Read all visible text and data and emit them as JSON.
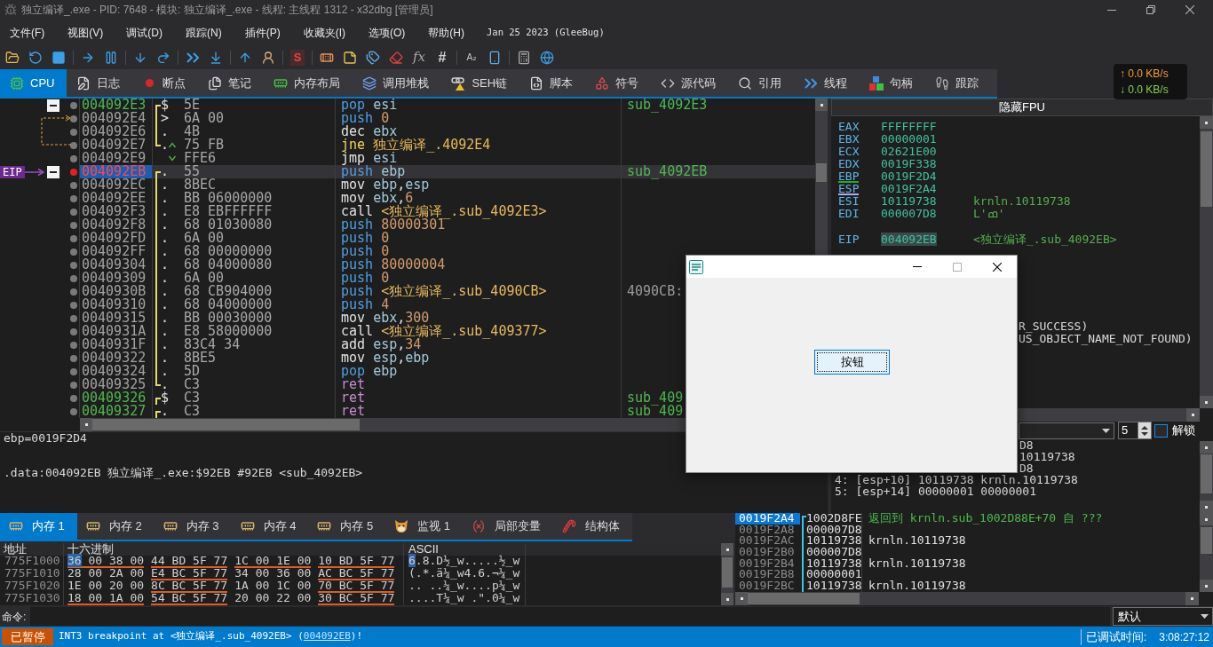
{
  "window": {
    "title": "独立编译_.exe - PID: 7648 - 模块: 独立编译_.exe - 线程: 主线程 1312 - x32dbg [管理员]"
  },
  "menu": [
    "文件(F)",
    "视图(V)",
    "调试(D)",
    "跟踪(N)",
    "插件(P)",
    "收藏夹(I)",
    "选项(O)",
    "帮助(H)"
  ],
  "build_info": "Jan 25 2023 (GleeBug)",
  "toolbar": {
    "glyphs": [
      "S",
      "fx",
      "#",
      "A₂"
    ]
  },
  "net_speed": {
    "upload": "↑ 0.0 KB/s",
    "download": "↓ 0.0 KB/s"
  },
  "tabs": [
    {
      "label": "CPU",
      "selected": true
    },
    {
      "label": "日志",
      "selected": false
    },
    {
      "label": "断点",
      "selected": false
    },
    {
      "label": "笔记",
      "selected": false
    },
    {
      "label": "内存布局",
      "selected": false
    },
    {
      "label": "调用堆栈",
      "selected": false
    },
    {
      "label": "SEH链",
      "selected": false
    },
    {
      "label": "脚本",
      "selected": false
    },
    {
      "label": "符号",
      "selected": false
    },
    {
      "label": "源代码",
      "selected": false
    },
    {
      "label": "引用",
      "selected": false
    },
    {
      "label": "线程",
      "selected": false
    },
    {
      "label": "句柄",
      "selected": false
    },
    {
      "label": "跟踪",
      "selected": false
    }
  ],
  "disassembly": {
    "eip_label": "EIP",
    "rows": [
      {
        "address": "004092E3",
        "kind": "function",
        "breakpoint": false,
        "selected": false,
        "collapse": true,
        "bracket": {
          "kind": "start"
        },
        "marker": "$",
        "bytes": "5E",
        "mnemonic": {
          "text": "pop",
          "kind": "stack"
        },
        "operands": [
          {
            "text": "esi",
            "kind": "reg"
          }
        ],
        "comment": {
          "text": "sub_4092E3",
          "kind": "label"
        }
      },
      {
        "address": "004092E4",
        "kind": "plain",
        "breakpoint": false,
        "selected": false,
        "collapse": false,
        "jump": {
          "kind": "target"
        },
        "bracket": {
          "kind": "mid"
        },
        "marker": ">",
        "bytes": "6A 00",
        "mnemonic": {
          "text": "push",
          "kind": "stack"
        },
        "operands": [
          {
            "text": "0",
            "kind": "num"
          }
        ]
      },
      {
        "address": "004092E6",
        "kind": "plain",
        "breakpoint": false,
        "selected": false,
        "collapse": false,
        "bracket": {
          "kind": "mid"
        },
        "marker": ".",
        "bytes": "4B",
        "mnemonic": {
          "text": "dec",
          "kind": "plain"
        },
        "operands": [
          {
            "text": "ebx",
            "kind": "reg"
          }
        ]
      },
      {
        "address": "004092E7",
        "kind": "plain",
        "breakpoint": false,
        "selected": false,
        "collapse": false,
        "jump": {
          "kind": "source"
        },
        "bracket": {
          "kind": "end"
        },
        "marker": ".",
        "branch": {
          "kind": "up"
        },
        "bytes": "75 FB",
        "mnemonic": {
          "text": "jne",
          "kind": "jcc"
        },
        "operands": [
          {
            "text": "独立编译_.4092E4",
            "kind": "target"
          }
        ]
      },
      {
        "address": "004092E9",
        "kind": "plain",
        "breakpoint": false,
        "selected": false,
        "collapse": false,
        "branch": {
          "kind": "down"
        },
        "bytes": "FFE6",
        "mnemonic": {
          "text": "jmp",
          "kind": "plain"
        },
        "operands": [
          {
            "text": "esi",
            "kind": "reg"
          }
        ]
      },
      {
        "address": "004092EB",
        "kind": "eip",
        "breakpoint": true,
        "selected": true,
        "collapse": true,
        "bracket": {
          "kind": "start"
        },
        "marker": ".",
        "bytes": "55",
        "mnemonic": {
          "text": "push",
          "kind": "stack"
        },
        "operands": [
          {
            "text": "ebp",
            "kind": "reg"
          }
        ],
        "comment": {
          "text": "sub_4092EB",
          "kind": "label"
        }
      },
      {
        "address": "004092EC",
        "kind": "plain",
        "breakpoint": false,
        "selected": false,
        "collapse": false,
        "bracket": {
          "kind": "mid"
        },
        "marker": ".",
        "bytes": "8BEC",
        "mnemonic": {
          "text": "mov",
          "kind": "plain"
        },
        "operands": [
          {
            "text": "ebp",
            "kind": "reg"
          },
          {
            "text": ",",
            "kind": "punct"
          },
          {
            "text": "esp",
            "kind": "reg"
          }
        ]
      },
      {
        "address": "004092EE",
        "kind": "plain",
        "breakpoint": false,
        "selected": false,
        "collapse": false,
        "bracket": {
          "kind": "mid"
        },
        "marker": ".",
        "bytes": "BB 06000000",
        "mnemonic": {
          "text": "mov",
          "kind": "plain"
        },
        "operands": [
          {
            "text": "ebx",
            "kind": "reg"
          },
          {
            "text": ",",
            "kind": "punct"
          },
          {
            "text": "6",
            "kind": "num"
          }
        ]
      },
      {
        "address": "004092F3",
        "kind": "plain",
        "breakpoint": false,
        "selected": false,
        "collapse": false,
        "bracket": {
          "kind": "mid"
        },
        "marker": ".",
        "bytes": "E8 EBFFFFFF",
        "mnemonic": {
          "text": "call",
          "kind": "plain"
        },
        "operands": [
          {
            "text": "<独立编译_.sub_4092E3>",
            "kind": "target"
          }
        ]
      },
      {
        "address": "004092F8",
        "kind": "plain",
        "breakpoint": false,
        "selected": false,
        "collapse": false,
        "bracket": {
          "kind": "mid"
        },
        "marker": ".",
        "bytes": "68 01030080",
        "mnemonic": {
          "text": "push",
          "kind": "stack"
        },
        "operands": [
          {
            "text": "80000301",
            "kind": "num"
          }
        ]
      },
      {
        "address": "004092FD",
        "kind": "plain",
        "breakpoint": false,
        "selected": false,
        "collapse": false,
        "bracket": {
          "kind": "mid"
        },
        "marker": ".",
        "bytes": "6A 00",
        "mnemonic": {
          "text": "push",
          "kind": "stack"
        },
        "operands": [
          {
            "text": "0",
            "kind": "num"
          }
        ]
      },
      {
        "address": "004092FF",
        "kind": "plain",
        "breakpoint": false,
        "selected": false,
        "collapse": false,
        "bracket": {
          "kind": "mid"
        },
        "marker": ".",
        "bytes": "68 00000000",
        "mnemonic": {
          "text": "push",
          "kind": "stack"
        },
        "operands": [
          {
            "text": "0",
            "kind": "num"
          }
        ]
      },
      {
        "address": "00409304",
        "kind": "plain",
        "breakpoint": false,
        "selected": false,
        "collapse": false,
        "bracket": {
          "kind": "mid"
        },
        "marker": ".",
        "bytes": "68 04000080",
        "mnemonic": {
          "text": "push",
          "kind": "stack"
        },
        "operands": [
          {
            "text": "80000004",
            "kind": "num"
          }
        ]
      },
      {
        "address": "00409309",
        "kind": "plain",
        "breakpoint": false,
        "selected": false,
        "collapse": false,
        "bracket": {
          "kind": "mid"
        },
        "marker": ".",
        "bytes": "6A 00",
        "mnemonic": {
          "text": "push",
          "kind": "stack"
        },
        "operands": [
          {
            "text": "0",
            "kind": "num"
          }
        ]
      },
      {
        "address": "0040930B",
        "kind": "plain",
        "breakpoint": false,
        "selected": false,
        "collapse": false,
        "bracket": {
          "kind": "mid"
        },
        "marker": ".",
        "bytes": "68 CB904000",
        "mnemonic": {
          "text": "push",
          "kind": "stack"
        },
        "operands": [
          {
            "text": "<独立编译_.sub_4090CB>",
            "kind": "target"
          }
        ],
        "comment": {
          "text": "4090CB:",
          "kind": "plain"
        }
      },
      {
        "address": "00409310",
        "kind": "plain",
        "breakpoint": false,
        "selected": false,
        "collapse": false,
        "bracket": {
          "kind": "mid"
        },
        "marker": ".",
        "bytes": "68 04000000",
        "mnemonic": {
          "text": "push",
          "kind": "stack"
        },
        "operands": [
          {
            "text": "4",
            "kind": "num"
          }
        ]
      },
      {
        "address": "00409315",
        "kind": "plain",
        "breakpoint": false,
        "selected": false,
        "collapse": false,
        "bracket": {
          "kind": "mid"
        },
        "marker": ".",
        "bytes": "BB 00030000",
        "mnemonic": {
          "text": "mov",
          "kind": "plain"
        },
        "operands": [
          {
            "text": "ebx",
            "kind": "reg"
          },
          {
            "text": ",",
            "kind": "punct"
          },
          {
            "text": "300",
            "kind": "num"
          }
        ]
      },
      {
        "address": "0040931A",
        "kind": "plain",
        "breakpoint": false,
        "selected": false,
        "collapse": false,
        "bracket": {
          "kind": "mid"
        },
        "marker": ".",
        "bytes": "E8 58000000",
        "mnemonic": {
          "text": "call",
          "kind": "plain"
        },
        "operands": [
          {
            "text": "<独立编译_.sub_409377>",
            "kind": "target"
          }
        ]
      },
      {
        "address": "0040931F",
        "kind": "plain",
        "breakpoint": false,
        "selected": false,
        "collapse": false,
        "bracket": {
          "kind": "mid"
        },
        "marker": ".",
        "bytes": "83C4 34",
        "mnemonic": {
          "text": "add",
          "kind": "plain"
        },
        "operands": [
          {
            "text": "esp",
            "kind": "reg"
          },
          {
            "text": ",",
            "kind": "punct"
          },
          {
            "text": "34",
            "kind": "num"
          }
        ]
      },
      {
        "address": "00409322",
        "kind": "plain",
        "breakpoint": false,
        "selected": false,
        "collapse": false,
        "bracket": {
          "kind": "mid"
        },
        "marker": ".",
        "bytes": "8BE5",
        "mnemonic": {
          "text": "mov",
          "kind": "plain"
        },
        "operands": [
          {
            "text": "esp",
            "kind": "reg"
          },
          {
            "text": ",",
            "kind": "punct"
          },
          {
            "text": "ebp",
            "kind": "reg"
          }
        ]
      },
      {
        "address": "00409324",
        "kind": "plain",
        "breakpoint": false,
        "selected": false,
        "collapse": false,
        "bracket": {
          "kind": "mid"
        },
        "marker": ".",
        "bytes": "5D",
        "mnemonic": {
          "text": "pop",
          "kind": "stack"
        },
        "operands": [
          {
            "text": "ebp",
            "kind": "reg"
          }
        ]
      },
      {
        "address": "00409325",
        "kind": "plain",
        "breakpoint": false,
        "selected": false,
        "collapse": false,
        "bracket": {
          "kind": "end"
        },
        "marker": ".",
        "bytes": "C3",
        "mnemonic": {
          "text": "ret",
          "kind": "ret"
        }
      },
      {
        "address": "00409326",
        "kind": "function",
        "breakpoint": false,
        "selected": false,
        "collapse": false,
        "bracket": {
          "kind": "start"
        },
        "marker": "$",
        "bytes": "C3",
        "mnemonic": {
          "text": "ret",
          "kind": "ret"
        },
        "comment": {
          "text": "sub_409",
          "kind": "label"
        }
      },
      {
        "address": "00409327",
        "kind": "function",
        "breakpoint": false,
        "selected": false,
        "collapse": false,
        "bracket": {
          "kind": "start"
        },
        "marker": ".",
        "bytes": "C3",
        "mnemonic": {
          "text": "ret",
          "kind": "ret"
        },
        "comment": {
          "text": "sub_409",
          "kind": "label"
        }
      }
    ]
  },
  "info_box": {
    "lines": [
      "ebp=0019F2D4",
      ".data:004092EB 独立编译_.exe:$92EB #92EB <sub_4092EB>"
    ]
  },
  "registers": {
    "header": "隐藏FPU",
    "groups": [
      [
        {
          "name": "EAX",
          "value": "FFFFFFFF",
          "selected": false
        },
        {
          "name": "EBX",
          "value": "00000001",
          "selected": false
        },
        {
          "name": "ECX",
          "value": "02621E00",
          "selected": false
        },
        {
          "name": "EDX",
          "value": "0019F338",
          "selected": false
        },
        {
          "name": "EBP",
          "value": "0019F2D4",
          "selected": false,
          "color": "#22a82e"
        },
        {
          "name": "ESP",
          "value": "0019F2A4",
          "selected": false,
          "color": "#b4a7f0"
        },
        {
          "name": "ESI",
          "value": "10119738",
          "selected": false,
          "comment": "krnln.10119738"
        },
        {
          "name": "EDI",
          "value": "000007D8",
          "selected": false,
          "comment": "L'ߘ'"
        }
      ],
      [
        {
          "name": "EIP",
          "value": "004092EB",
          "selected": true,
          "comment": "<独立编译_.sub_4092EB>"
        }
      ]
    ],
    "lines": [
      {
        "text": "R_SUCCESS)",
        "kind": "covered"
      },
      {
        "text": "US_OBJECT_NAME_NOT_FOUND)",
        "kind": "covered"
      }
    ]
  },
  "arguments": {
    "count": "5",
    "unlock": {
      "label": "解锁",
      "checked": false
    },
    "lines": [
      {
        "text": "D8",
        "kind": "covered"
      },
      {
        "text": "10119738",
        "kind": "covered"
      },
      {
        "text": "D8",
        "kind": "covered"
      },
      {
        "text": "4: [esp+10] 10119738 krnln.10119738",
        "kind": "full"
      },
      {
        "text": "5: [esp+14] 00000001 00000001",
        "kind": "full"
      }
    ]
  },
  "memory_tabs": [
    {
      "label": "内存 1",
      "selected": true
    },
    {
      "label": "内存 2",
      "selected": false
    },
    {
      "label": "内存 3",
      "selected": false
    },
    {
      "label": "内存 4",
      "selected": false
    },
    {
      "label": "内存 5",
      "selected": false
    },
    {
      "label": "监视 1",
      "selected": false
    },
    {
      "label": "局部变量",
      "selected": false
    },
    {
      "label": "结构体",
      "selected": false
    }
  ],
  "memory_dump": {
    "columns": [
      "地址",
      "十六进制",
      "ASCII"
    ],
    "rows": [
      {
        "address": "775F1000",
        "selected": true,
        "groups": [
          {
            "bytes": [
              "36",
              "00",
              "38",
              "00"
            ],
            "underlined": true
          },
          {
            "bytes": [
              "44",
              "BD",
              "5F",
              "77"
            ],
            "underlined": true
          },
          {
            "bytes": [
              "1C",
              "00",
              "1E",
              "00"
            ],
            "underlined": true
          },
          {
            "bytes": [
              "10",
              "BD",
              "5F",
              "77"
            ],
            "underlined": true
          }
        ],
        "ascii": "6.8.D½_w.....½_w"
      },
      {
        "address": "775F1010",
        "selected": false,
        "groups": [
          {
            "bytes": [
              "28",
              "00",
              "2A",
              "00"
            ],
            "underlined": false
          },
          {
            "bytes": [
              "E4",
              "BC",
              "5F",
              "77"
            ],
            "underlined": true
          },
          {
            "bytes": [
              "34",
              "00",
              "36",
              "00"
            ],
            "underlined": false
          },
          {
            "bytes": [
              "AC",
              "BC",
              "5F",
              "77"
            ],
            "underlined": true
          }
        ],
        "ascii": "(.*.ä¼_w4.6.¬¼_w"
      },
      {
        "address": "775F1020",
        "selected": false,
        "groups": [
          {
            "bytes": [
              "1E",
              "00",
              "20",
              "00"
            ],
            "underlined": false
          },
          {
            "bytes": [
              "8C",
              "BC",
              "5F",
              "77"
            ],
            "underlined": true
          },
          {
            "bytes": [
              "1A",
              "00",
              "1C",
              "00"
            ],
            "underlined": false
          },
          {
            "bytes": [
              "70",
              "BC",
              "5F",
              "77"
            ],
            "underlined": true
          }
        ],
        "ascii": ".. ..¼_w....p¼_w"
      },
      {
        "address": "775F1030",
        "selected": false,
        "groups": [
          {
            "bytes": [
              "18",
              "00",
              "1A",
              "00"
            ],
            "underlined": true
          },
          {
            "bytes": [
              "54",
              "BC",
              "5F",
              "77"
            ],
            "underlined": true
          },
          {
            "bytes": [
              "20",
              "00",
              "22",
              "00"
            ],
            "underlined": false
          },
          {
            "bytes": [
              "30",
              "BC",
              "5F",
              "77"
            ],
            "underlined": true
          }
        ],
        "ascii": "....T¼_w .\".0¼_w"
      }
    ]
  },
  "stack": {
    "rows": [
      {
        "address": "0019F2A4",
        "value": "1002D8FE",
        "selected": true,
        "frame": {
          "kind": "start"
        },
        "comment": {
          "text": "返回到 krnln.sub_1002D88E+70 自 ???",
          "kind": "return"
        }
      },
      {
        "address": "0019F2A8",
        "value": "000007D8",
        "selected": false,
        "frame": {
          "kind": "mid"
        }
      },
      {
        "address": "0019F2AC",
        "value": "10119738",
        "selected": false,
        "frame": {
          "kind": "mid"
        },
        "comment": {
          "text": "krnln.10119738",
          "kind": "plain"
        }
      },
      {
        "address": "0019F2B0",
        "value": "000007D8",
        "selected": false,
        "frame": {
          "kind": "mid"
        }
      },
      {
        "address": "0019F2B4",
        "value": "10119738",
        "selected": false,
        "frame": {
          "kind": "mid"
        },
        "comment": {
          "text": "krnln.10119738",
          "kind": "plain"
        }
      },
      {
        "address": "0019F2B8",
        "value": "00000001",
        "selected": false,
        "frame": {
          "kind": "mid"
        }
      },
      {
        "address": "0019F2BC",
        "value": "10119738",
        "selected": false,
        "frame": {
          "kind": "mid"
        },
        "comment": {
          "text": "krnln.10119738",
          "kind": "plain"
        }
      }
    ]
  },
  "command": {
    "label": "命令:",
    "mode": "默认"
  },
  "status_bar": {
    "state": "已暂停",
    "message": {
      "before": "INT3 breakpoint at <独立编译_.sub_4092EB> (",
      "link": "004092EB",
      "after": ")!"
    },
    "elapsed_label": "已调试时间:",
    "elapsed": "3:08:27:12"
  },
  "dialog": {
    "button": "按钮"
  }
}
